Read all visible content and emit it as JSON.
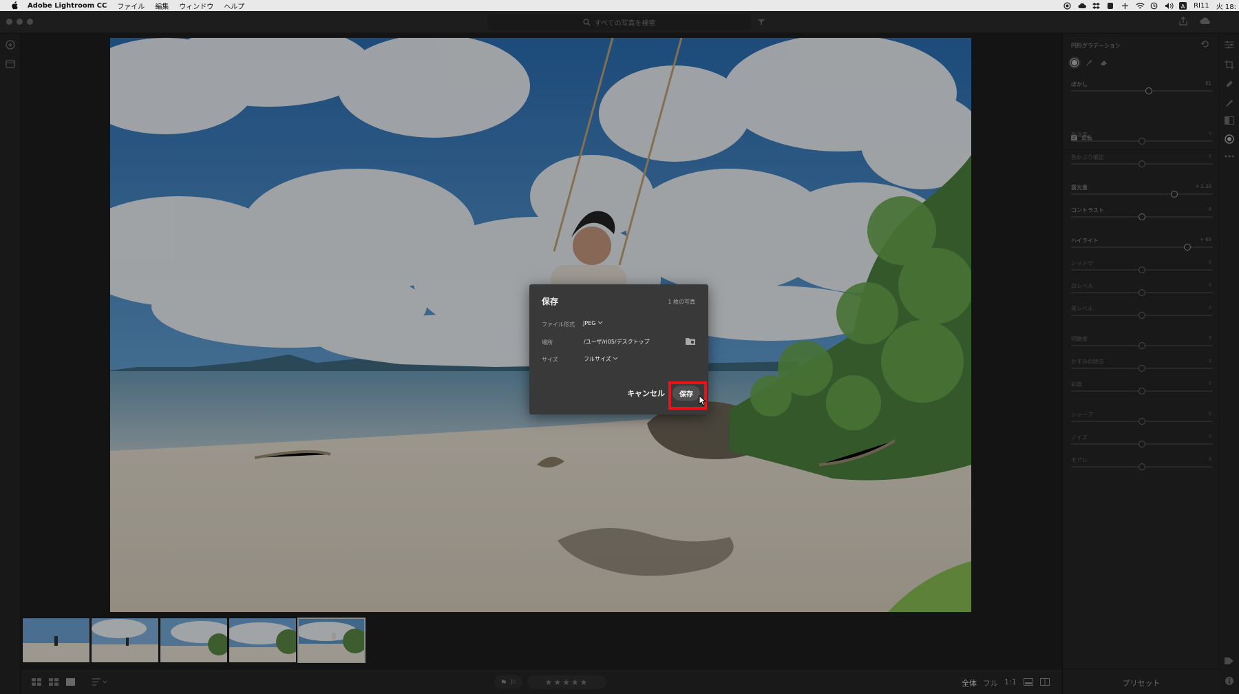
{
  "menubar": {
    "app_name": "Adobe Lightroom CC",
    "items": [
      "ファイル",
      "編集",
      "ウィンドウ",
      "ヘルプ"
    ],
    "right_text": "RI11",
    "clock": "火 18:"
  },
  "toolbar": {
    "search_placeholder": "すべての写真を検索"
  },
  "dialog": {
    "title": "保存",
    "count": "1 枚の写真",
    "format_label": "ファイル形式",
    "format_value": "JPEG",
    "location_label": "場所",
    "location_value": "/ユーザ/ri05/デスクトップ",
    "size_label": "サイズ",
    "size_value": "フルサイズ",
    "cancel_label": "キャンセル",
    "save_label": "保存"
  },
  "right_panel": {
    "title": "円形グラデーション",
    "invert_label": "反転",
    "sliders": [
      {
        "label": "ぼかし",
        "value": "61",
        "pos": 0.55
      },
      {
        "label": "色温度",
        "value": "0",
        "pos": 0.5
      },
      {
        "label": "色かぶり補正",
        "value": "0",
        "pos": 0.5
      },
      {
        "label": "露光量",
        "value": "+ 2.30",
        "pos": 0.73
      },
      {
        "label": "コントラスト",
        "value": "0",
        "pos": 0.5
      },
      {
        "label": "ハイライト",
        "value": "+ 65",
        "pos": 0.82
      },
      {
        "label": "シャドウ",
        "value": "0",
        "pos": 0.5
      },
      {
        "label": "白レベル",
        "value": "0",
        "pos": 0.5
      },
      {
        "label": "黒レベル",
        "value": "0",
        "pos": 0.5
      },
      {
        "label": "明瞭度",
        "value": "0",
        "pos": 0.5
      },
      {
        "label": "かすみの除去",
        "value": "0",
        "pos": 0.5
      },
      {
        "label": "彩度",
        "value": "0",
        "pos": 0.5
      },
      {
        "label": "シャープ",
        "value": "0",
        "pos": 0.5
      },
      {
        "label": "ノイズ",
        "value": "0",
        "pos": 0.5
      },
      {
        "label": "モアレ",
        "value": "0",
        "pos": 0.5
      }
    ],
    "preset_label": "プリセット"
  },
  "bottombar": {
    "view_all": "全体",
    "view_full": "フル",
    "view_1to1": "1:1",
    "stars": "★★★★★"
  },
  "filmstrip": {
    "count": 5,
    "selected_index": 4
  }
}
